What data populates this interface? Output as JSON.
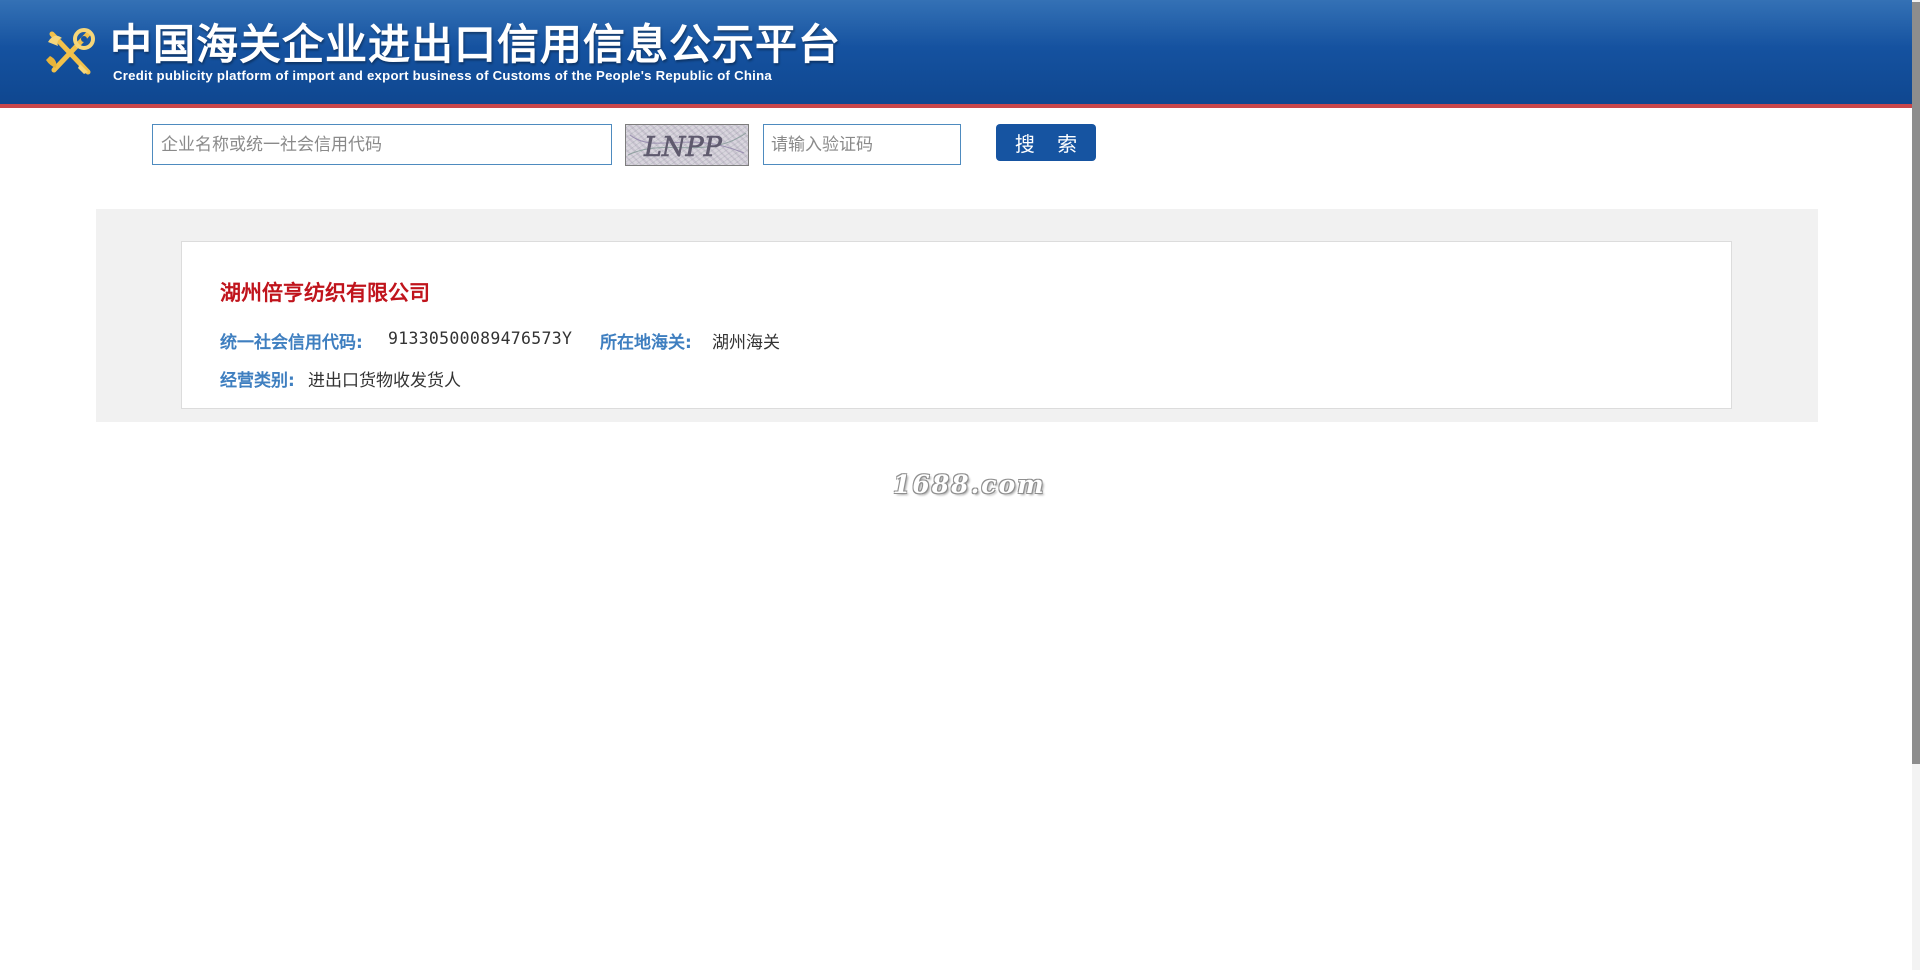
{
  "header": {
    "title": "中国海关企业进出口信用信息公示平台",
    "subtitle": "Credit publicity platform of import and export business of Customs of the People's Republic of China",
    "logo_icon": "customs-emblem-icon",
    "colors": {
      "banner_blue": "#1552a0",
      "banner_border": "#c9474b"
    }
  },
  "search": {
    "query_placeholder": "企业名称或统一社会信用代码",
    "captcha_text": "LNPP",
    "captcha_placeholder": "请输入验证码",
    "button_label": "搜 索",
    "button_color": "#1654a1"
  },
  "result": {
    "company_name": "湖州倍亨纺织有限公司",
    "credit_code_label": "统一社会信用代码:",
    "credit_code_value": "91330500089476573Y",
    "customs_label": "所在地海关:",
    "customs_value": "湖州海关",
    "business_type_label": "经营类别:",
    "business_type_value": "进出口货物收发货人",
    "colors": {
      "company_name": "#c0141c",
      "label": "#3f7fc0"
    }
  },
  "watermark": "1688.com"
}
